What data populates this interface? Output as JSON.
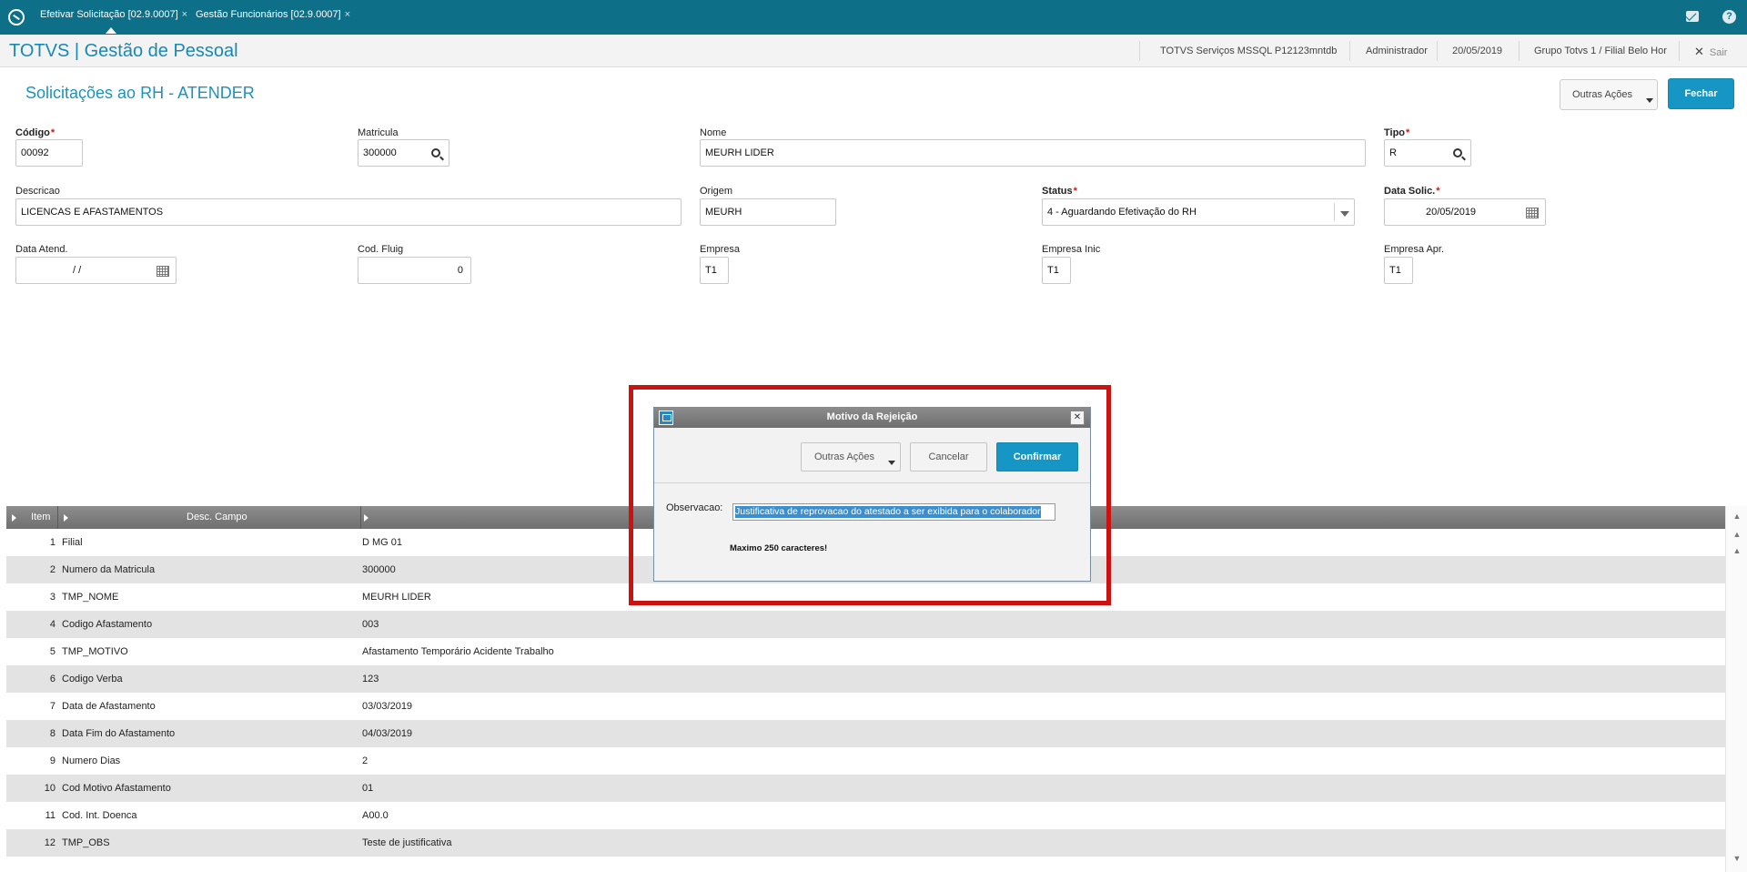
{
  "tabs": [
    {
      "label": "Efetivar Solicitação [02.9.0007]",
      "close": "×"
    },
    {
      "label": "Gestão Funcionários [02.9.0007]",
      "close": "×"
    }
  ],
  "header": {
    "app_title": "TOTVS | Gestão de Pessoal",
    "environment": "TOTVS Serviços MSSQL P12123mntdb",
    "user": "Administrador",
    "date": "20/05/2019",
    "branch": "Grupo Totvs 1 / Filial Belo Hor",
    "exit_label": "Sair",
    "exit_icon": "✕"
  },
  "page": {
    "title": "Solicitações ao RH - ATENDER",
    "other_actions_label": "Outras Ações",
    "close_label": "Fechar"
  },
  "form": {
    "codigo": {
      "label": "Código",
      "value": "00092"
    },
    "matricula": {
      "label": "Matricula",
      "value": "300000"
    },
    "nome": {
      "label": "Nome",
      "value": "MEURH LIDER"
    },
    "tipo": {
      "label": "Tipo",
      "value": "R"
    },
    "descricao": {
      "label": "Descricao",
      "value": "LICENCAS E AFASTAMENTOS"
    },
    "origem": {
      "label": "Origem",
      "value": "MEURH"
    },
    "status": {
      "label": "Status",
      "value": "4 - Aguardando Efetivação do RH"
    },
    "data_solic": {
      "label": "Data Solic.",
      "value": "20/05/2019"
    },
    "data_atend": {
      "label": "Data Atend.",
      "value": "/ /"
    },
    "cod_fluig": {
      "label": "Cod. Fluig",
      "value": "0"
    },
    "empresa": {
      "label": "Empresa",
      "value": "T1"
    },
    "empresa_inic": {
      "label": "Empresa Inic",
      "value": "T1"
    },
    "empresa_apr": {
      "label": "Empresa Apr.",
      "value": "T1"
    },
    "required_mark": "*"
  },
  "grid": {
    "columns": [
      "Item",
      "Desc. Campo",
      ""
    ],
    "rows": [
      {
        "item": "1",
        "desc": "Filial",
        "value": "D MG 01"
      },
      {
        "item": "2",
        "desc": "Numero da Matricula",
        "value": "300000"
      },
      {
        "item": "3",
        "desc": "TMP_NOME",
        "value": "MEURH LIDER"
      },
      {
        "item": "4",
        "desc": "Codigo Afastamento",
        "value": "003"
      },
      {
        "item": "5",
        "desc": "TMP_MOTIVO",
        "value": "Afastamento Temporário Acidente Trabalho"
      },
      {
        "item": "6",
        "desc": "Codigo Verba",
        "value": "123"
      },
      {
        "item": "7",
        "desc": "Data de Afastamento",
        "value": "03/03/2019"
      },
      {
        "item": "8",
        "desc": "Data Fim do Afastamento",
        "value": "04/03/2019"
      },
      {
        "item": "9",
        "desc": "Numero Dias",
        "value": "2"
      },
      {
        "item": "10",
        "desc": "Cod Motivo Afastamento",
        "value": "01"
      },
      {
        "item": "11",
        "desc": "Cod. Int. Doenca",
        "value": "A00.0"
      },
      {
        "item": "12",
        "desc": "TMP_OBS",
        "value": "Teste de justificativa"
      }
    ]
  },
  "dialog": {
    "title": "Motivo da Rejeição",
    "close_icon": "✕",
    "other_actions_label": "Outras Ações",
    "cancel_label": "Cancelar",
    "confirm_label": "Confirmar",
    "observation_label": "Observacao:",
    "observation_value": "Justificativa de reprovacao do atestado a ser exibida para o colaborador",
    "hint": "Maximo 250 caracteres!"
  },
  "colors": {
    "topbar": "#0e6f89",
    "accent": "#1596c4",
    "highlight_border": "#cc1111",
    "required": "#dd1111"
  }
}
